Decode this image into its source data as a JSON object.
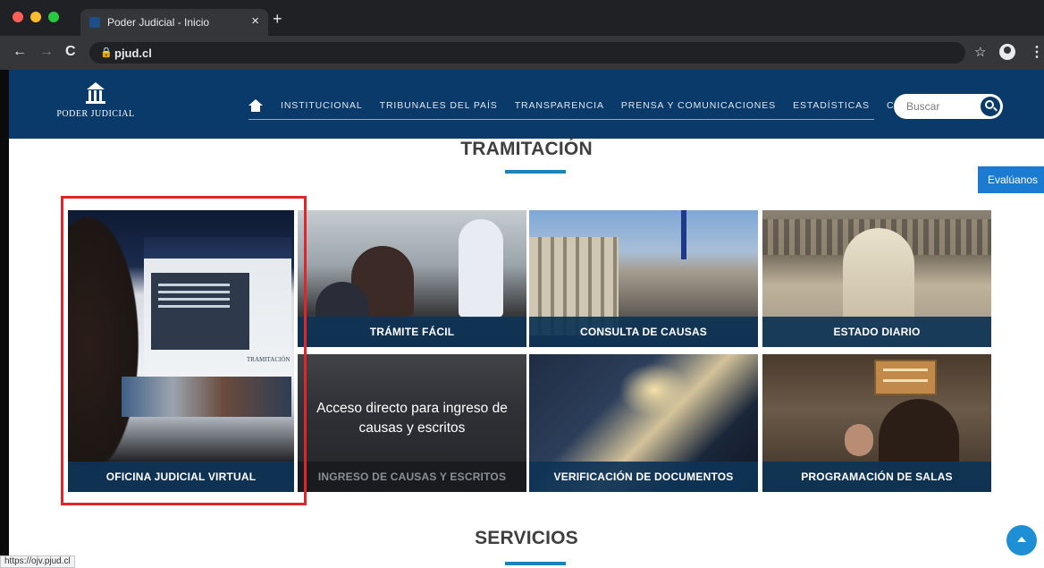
{
  "browser": {
    "tab_title": "Poder Judicial - Inicio",
    "close_glyph": "×",
    "new_tab_glyph": "+",
    "back_glyph": "←",
    "forward_glyph": "→",
    "reload_glyph": "C",
    "url": "pjud.cl",
    "star_glyph": "☆",
    "menu_glyph": "⋮",
    "lock_glyph": "🔒",
    "status_url": "https://ojv.pjud.cl"
  },
  "header": {
    "logo_text": "PODER JUDICIAL",
    "menu": [
      "INSTITUCIONAL",
      "TRIBUNALES DEL PAÍS",
      "TRANSPARENCIA",
      "PRENSA Y COMUNICACIONES",
      "ESTADÍSTICAS",
      "CAPJ"
    ],
    "search_placeholder": "Buscar"
  },
  "sections": {
    "tramitacion_title": "TRAMITACIÓN",
    "servicios_title": "SERVICIOS",
    "evaluanos_label": "Evalúanos"
  },
  "cards": {
    "ojv": "OFICINA JUDICIAL VIRTUAL",
    "ojv_screen_text": "TRAMITACIÓN",
    "tramite": "TRÁMITE FÁCIL",
    "consulta": "CONSULTA DE CAUSAS",
    "estado": "ESTADO DIARIO",
    "ingreso": "INGRESO DE CAUSAS Y ESCRITOS",
    "ingreso_overlay": "Acceso directo para ingreso de causas y escritos",
    "verificacion": "VERIFICACIÓN DE DOCUMENTOS",
    "salas": "PROGRAMACIÓN DE SALAS"
  },
  "colors": {
    "header_bg": "#093a69",
    "accent_rule": "#1a83b7",
    "highlight": "#e0262c",
    "card_label_bg": "#0e3456"
  },
  "icons": [
    "home-icon",
    "search-icon",
    "chevron-up-icon",
    "lock-icon",
    "star-icon",
    "profile-icon"
  ]
}
